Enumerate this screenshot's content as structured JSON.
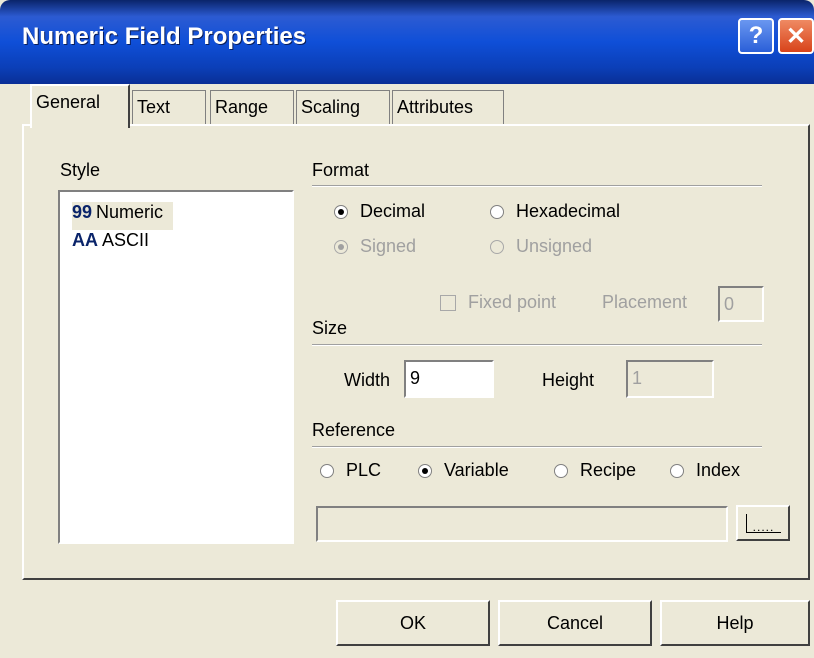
{
  "window": {
    "title": "Numeric Field Properties"
  },
  "titlebar_buttons": {
    "help": "?",
    "close": "✕"
  },
  "tabs": [
    {
      "label": "General",
      "active": true
    },
    {
      "label": "Text"
    },
    {
      "label": "Range"
    },
    {
      "label": "Scaling"
    },
    {
      "label": "Attributes"
    }
  ],
  "style": {
    "label": "Style",
    "items": [
      {
        "glyph": "99",
        "label": "Numeric",
        "selected": true
      },
      {
        "glyph": "AA",
        "label": "ASCII"
      }
    ]
  },
  "format": {
    "label": "Format",
    "decimal": "Decimal",
    "hexadecimal": "Hexadecimal",
    "signed": "Signed",
    "unsigned": "Unsigned",
    "fixed_point": "Fixed point",
    "placement_label": "Placement",
    "placement_value": "0"
  },
  "size": {
    "label": "Size",
    "width_label": "Width",
    "width_value": "9",
    "height_label": "Height",
    "height_value": "1"
  },
  "reference": {
    "label": "Reference",
    "options": [
      "PLC",
      "Variable",
      "Recipe",
      "Index"
    ],
    "selected": "Variable",
    "value": "",
    "browse": "....."
  },
  "buttons": {
    "ok": "OK",
    "cancel": "Cancel",
    "help": "Help"
  }
}
